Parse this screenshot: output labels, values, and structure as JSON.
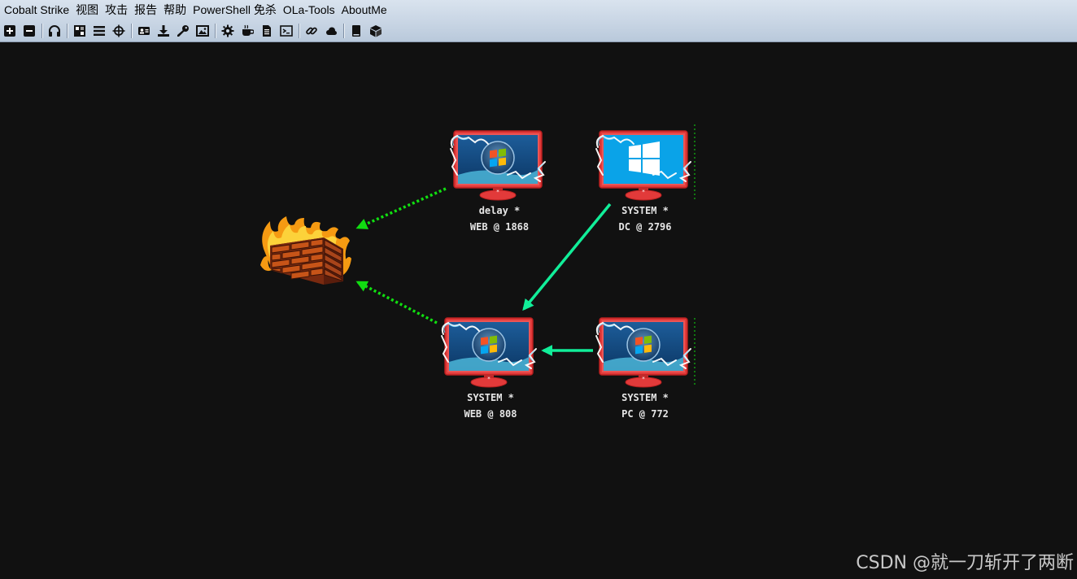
{
  "menu": [
    "Cobalt Strike",
    "视图",
    "攻击",
    "报告",
    "帮助",
    "PowerShell 免杀",
    "OLa-Tools",
    "AboutMe"
  ],
  "toolbar_icons": [
    "plus-icon",
    "minus-icon",
    "headphones-icon",
    "pivot-graph-icon",
    "list-icon",
    "target-icon",
    "credentials-icon",
    "download-icon",
    "key-icon",
    "image-icon",
    "gear-icon",
    "coffee-icon",
    "document-icon",
    "terminal-icon",
    "link-icon",
    "cloud-icon",
    "book-icon",
    "cube-icon"
  ],
  "nodes": [
    {
      "id": "web1868",
      "os": "win7",
      "line1": "delay *",
      "line2": "WEB @ 1868"
    },
    {
      "id": "dc2796",
      "os": "win10",
      "line1": "SYSTEM *",
      "line2": "DC @ 2796"
    },
    {
      "id": "web808",
      "os": "win7",
      "line1": "SYSTEM *",
      "line2": "WEB @ 808"
    },
    {
      "id": "pc772",
      "os": "win7",
      "line1": "SYSTEM *",
      "line2": "PC @ 772"
    }
  ],
  "colors": {
    "background": "#111111",
    "egress_link": "#11dd11",
    "smb_link": "#11ee99",
    "monitor_frame": "#e23a3a",
    "label_text": "#e6e6e6"
  },
  "watermark": "CSDN @就一刀斩开了两断"
}
